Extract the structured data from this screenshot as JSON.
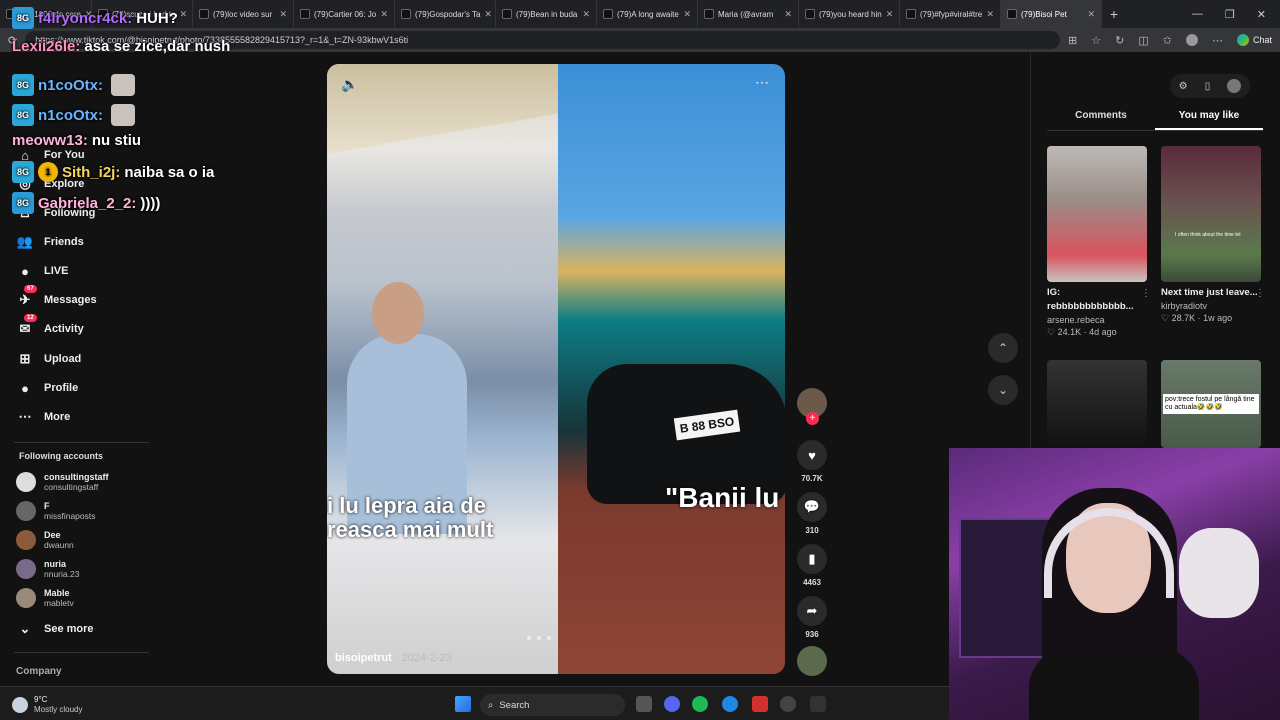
{
  "browser": {
    "tabs": [
      {
        "title": "(79)1000 de cere"
      },
      {
        "title": "(79)scuze i had to"
      },
      {
        "title": "(79)loc video sur"
      },
      {
        "title": "(79)Cartier 06: Jo"
      },
      {
        "title": "(79)Gospodar's Ta"
      },
      {
        "title": "(79)Bean in buda"
      },
      {
        "title": "(79)A long awaite"
      },
      {
        "title": "Maria (@avram"
      },
      {
        "title": "(79)you heard hin"
      },
      {
        "title": "(79)#fyp#viral#tre"
      },
      {
        "title": "(79)Bisoi Pet"
      }
    ],
    "url": "https://www.tiktok.com/@bisoipetrut/photo/7338555582829415713?_r=1&_t=ZN-93kbwV1s6ti",
    "chat_label": "Chat"
  },
  "chat_overlay": [
    {
      "user": "f4lryoncr4ck:",
      "color": "#b36bff",
      "msg": "HUH?"
    },
    {
      "user": "Lexii26le:",
      "color": "#ff8fc2",
      "msg": "asa se zice,dar nush"
    },
    {
      "user": "n1coOtx:",
      "color": "#6bb6ff",
      "msg": ""
    },
    {
      "user": "n1coOtx:",
      "color": "#6bb6ff",
      "msg": ""
    },
    {
      "user": "meoww13:",
      "color": "#ffb3d9",
      "msg": "nu stiu"
    },
    {
      "user": "Sith_i2j:",
      "color": "#f6d55c",
      "msg": "naiba sa o ia"
    },
    {
      "user": "Gabriela_2_2:",
      "color": "#ffb3d9",
      "msg": "))))"
    }
  ],
  "chat_sub_count": "1",
  "sidebar": {
    "nav": [
      {
        "label": "For You",
        "icon": "home-icon"
      },
      {
        "label": "Explore",
        "icon": "compass-icon"
      },
      {
        "label": "Following",
        "icon": "following-icon"
      },
      {
        "label": "Friends",
        "icon": "friends-icon"
      },
      {
        "label": "LIVE",
        "icon": "live-icon"
      },
      {
        "label": "Messages",
        "icon": "messages-icon",
        "badge": "67"
      },
      {
        "label": "Activity",
        "icon": "activity-icon",
        "badge": "12"
      },
      {
        "label": "Upload",
        "icon": "upload-icon"
      },
      {
        "label": "Profile",
        "icon": "profile-icon"
      },
      {
        "label": "More",
        "icon": "more-icon"
      }
    ],
    "following_title": "Following accounts",
    "following": [
      {
        "name": "consultingstaff",
        "handle": "consultingstaff"
      },
      {
        "name": "F",
        "handle": "missfinaposts"
      },
      {
        "name": "Dee",
        "handle": "dwaunn"
      },
      {
        "name": "nuria",
        "handle": "nnuria.23"
      },
      {
        "name": "Mable",
        "handle": "mabletv"
      }
    ],
    "see_more": "See more",
    "company": "Company"
  },
  "video": {
    "caption_left_1": "i lu lepra aia de",
    "caption_left_2": "reasca mai mult",
    "caption_right": "\"Banii lu",
    "plate": "B 88 BSO",
    "username": "bisoipetrut",
    "date": "2024-2-23"
  },
  "actions": {
    "likes": "70.7K",
    "comments": "310",
    "saves": "4463",
    "shares": "936"
  },
  "right_panel": {
    "tabs": [
      {
        "label": "Comments"
      },
      {
        "label": "You may like"
      }
    ],
    "active_tab": "You may like",
    "cards": [
      {
        "title": "IG: rebbbbbbbbbbbb...",
        "user": "arsene.rebeca",
        "likes": "24.1K",
        "age": "4d ago"
      },
      {
        "title": "Next time just leave...",
        "user": "kirbyradiotv",
        "likes": "28.7K",
        "age": "1w ago"
      },
      {
        "title": "",
        "user": "",
        "likes": "",
        "age": ""
      },
      {
        "title": "pov:trece fostul pe lângă tine cu actuala🤣🤣🤣",
        "user": "",
        "likes": "",
        "age": ""
      }
    ],
    "card2_overlay": "I often think about the time let"
  },
  "taskbar": {
    "temp": "9°C",
    "weather": "Mostly cloudy",
    "search_label": "Search"
  }
}
